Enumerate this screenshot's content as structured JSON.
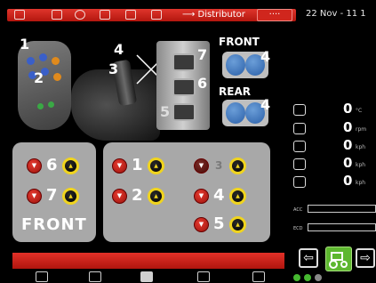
{
  "topbar": {
    "title": "Distributor",
    "button_label": "····",
    "date": "22 Nov - 11 1"
  },
  "machine": {
    "callouts": [
      "1",
      "2",
      "3",
      "4",
      "5",
      "6",
      "7",
      "4",
      "4"
    ],
    "axle_front_label": "FRONT",
    "axle_rear_label": "REAR"
  },
  "readouts": {
    "rows": [
      {
        "value": "0",
        "unit": "°C"
      },
      {
        "value": "0",
        "unit": "rpm"
      },
      {
        "value": "0",
        "unit": "kph"
      },
      {
        "value": "0",
        "unit": "kph"
      },
      {
        "value": "0",
        "unit": "kph"
      }
    ],
    "acc_label": "ACC",
    "ecd_label": "ECD"
  },
  "valves": {
    "front_panel": {
      "rows": [
        {
          "number": "6"
        },
        {
          "number": "7"
        }
      ],
      "label": "FRONT"
    },
    "rear_panel": {
      "rows": [
        {
          "number": "1"
        },
        {
          "number": "3"
        },
        {
          "number": "2"
        },
        {
          "number": "4"
        },
        {
          "number": "5"
        }
      ]
    }
  },
  "nav": {
    "left_arrow": "⇦",
    "right_arrow": "⇨"
  },
  "colors": {
    "accent_red": "#d0261d",
    "panel_grey": "#a8a8a8",
    "valve_yellow": "#f0d41e",
    "nav_green": "#5db72f"
  }
}
